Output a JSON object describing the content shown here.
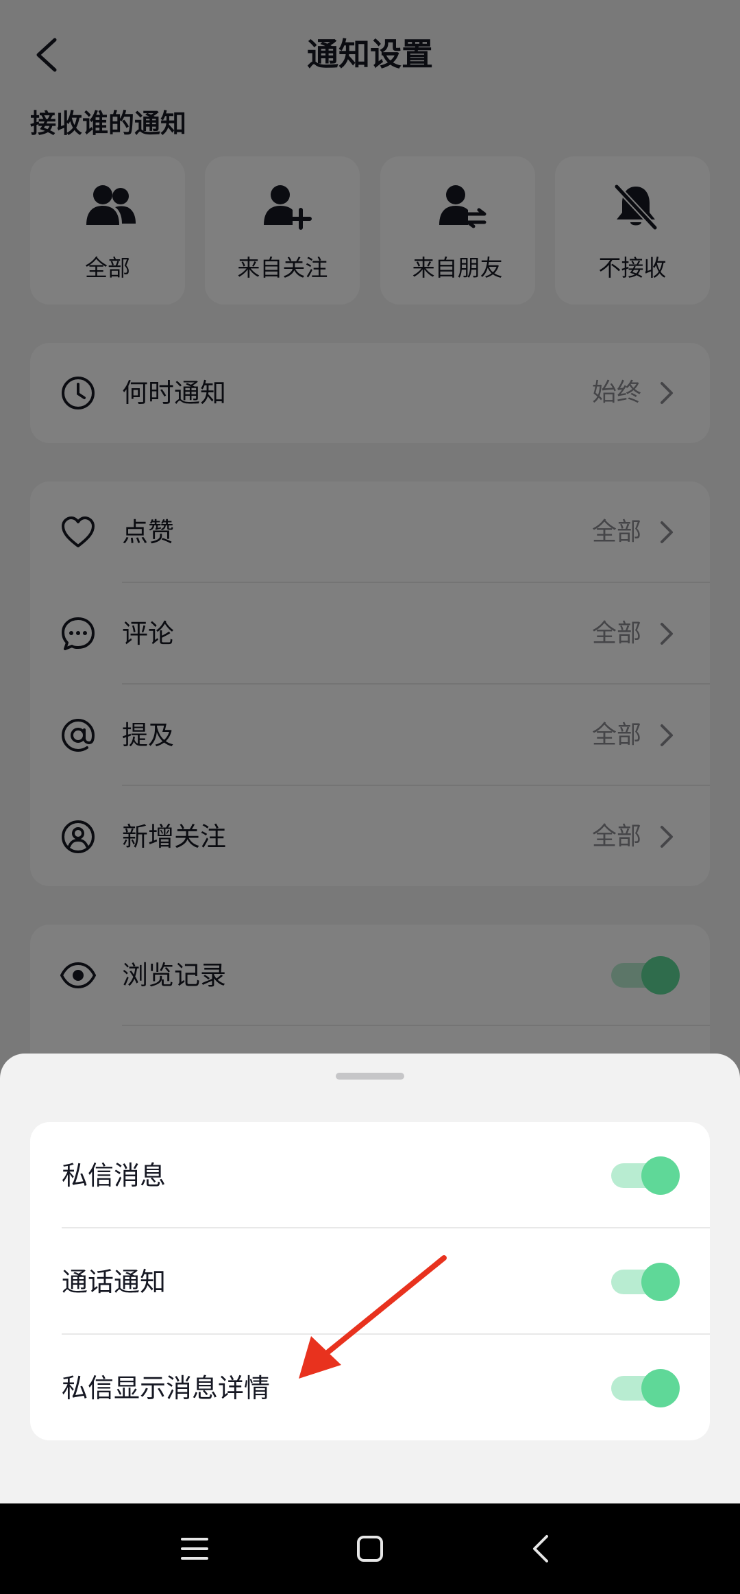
{
  "header": {
    "title": "通知设置",
    "back_icon": "chevron-left-icon"
  },
  "who_section": {
    "title": "接收谁的通知",
    "options": [
      {
        "label": "全部",
        "icon": "two-users-icon"
      },
      {
        "label": "来自关注",
        "icon": "user-plus-icon"
      },
      {
        "label": "来自朋友",
        "icon": "user-swap-icon"
      },
      {
        "label": "不接收",
        "icon": "bell-off-icon"
      }
    ]
  },
  "when": {
    "label": "何时通知",
    "value": "始终",
    "icon": "clock-icon"
  },
  "interactions": [
    {
      "label": "点赞",
      "value": "全部",
      "icon": "heart-icon"
    },
    {
      "label": "评论",
      "value": "全部",
      "icon": "comment-icon"
    },
    {
      "label": "提及",
      "value": "全部",
      "icon": "at-icon"
    },
    {
      "label": "新增关注",
      "value": "全部",
      "icon": "user-circle-icon"
    }
  ],
  "browsing": {
    "label": "浏览记录",
    "on": true,
    "icon": "eye-icon"
  },
  "sheet": {
    "items": [
      {
        "label": "私信消息",
        "on": true
      },
      {
        "label": "通话通知",
        "on": true
      },
      {
        "label": "私信显示消息详情",
        "on": true
      }
    ]
  },
  "navbar": {
    "icons": [
      "menu-icon",
      "home-square-icon",
      "back-triangle-icon"
    ]
  },
  "colors": {
    "toggle_on": "#5fd898",
    "toggle_track": "#b8ecd1",
    "annotation_arrow": "#e8321e",
    "overlay": "rgba(0,0,0,0.5)"
  }
}
